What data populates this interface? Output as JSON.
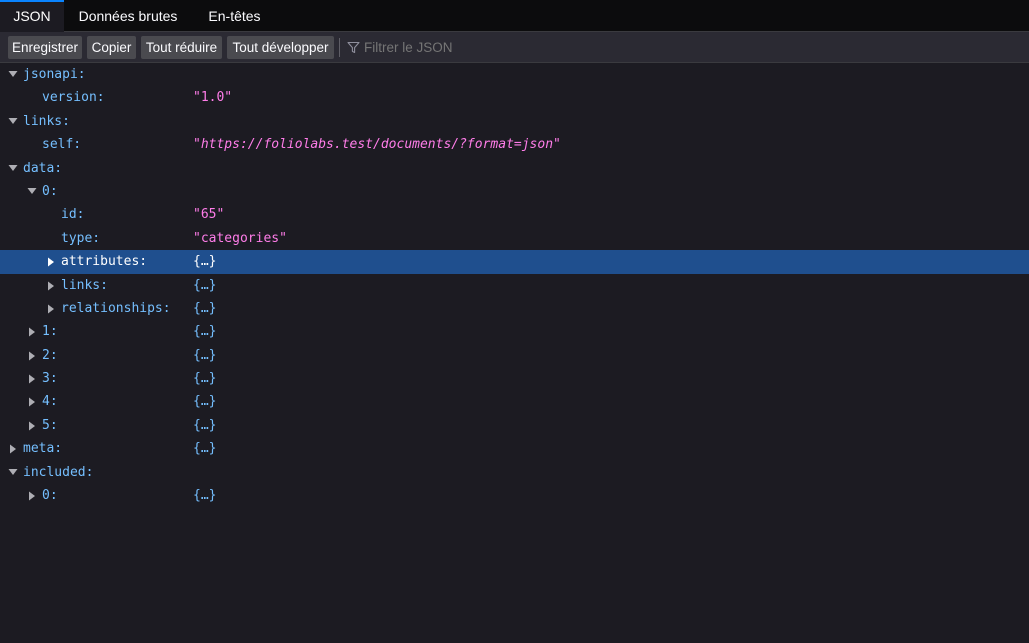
{
  "tabs": {
    "json": "JSON",
    "raw": "Données brutes",
    "headers": "En-têtes"
  },
  "toolbar": {
    "save": "Enregistrer",
    "copy": "Copier",
    "collapse_all": "Tout réduire",
    "expand_all": "Tout développer",
    "filter_placeholder": "Filtrer le JSON",
    "filter_icon": "filter-funnel-icon"
  },
  "tree": {
    "jsonapi_key": "jsonapi:",
    "version_key": "version:",
    "version_value": "\"1.0\"",
    "links_key": "links:",
    "self_key": "self:",
    "self_value": "\"https://foliolabs.test/documents/?format=json\"",
    "data_key": "data:",
    "item0_key": "0:",
    "id_key": "id:",
    "id_value": "\"65\"",
    "type_key": "type:",
    "type_value": "\"categories\"",
    "attributes_key": "attributes:",
    "attributes_value": "{…}",
    "item_links_key": "links:",
    "item_links_value": "{…}",
    "relationships_key": "relationships:",
    "relationships_value": "{…}",
    "collapsed_items": [
      {
        "key": "1:",
        "value": "{…}"
      },
      {
        "key": "2:",
        "value": "{…}"
      },
      {
        "key": "3:",
        "value": "{…}"
      },
      {
        "key": "4:",
        "value": "{…}"
      },
      {
        "key": "5:",
        "value": "{…}"
      }
    ],
    "meta_key": "meta:",
    "meta_value": "{…}",
    "included_key": "included:",
    "included0_key": "0:",
    "included0_value": "{…}"
  },
  "colors": {
    "background": "#1c1b22",
    "key": "#75bfff",
    "string": "#ff7de9",
    "selected_row": "#1f4f8e",
    "active_tab_accent": "#0a84ff"
  }
}
